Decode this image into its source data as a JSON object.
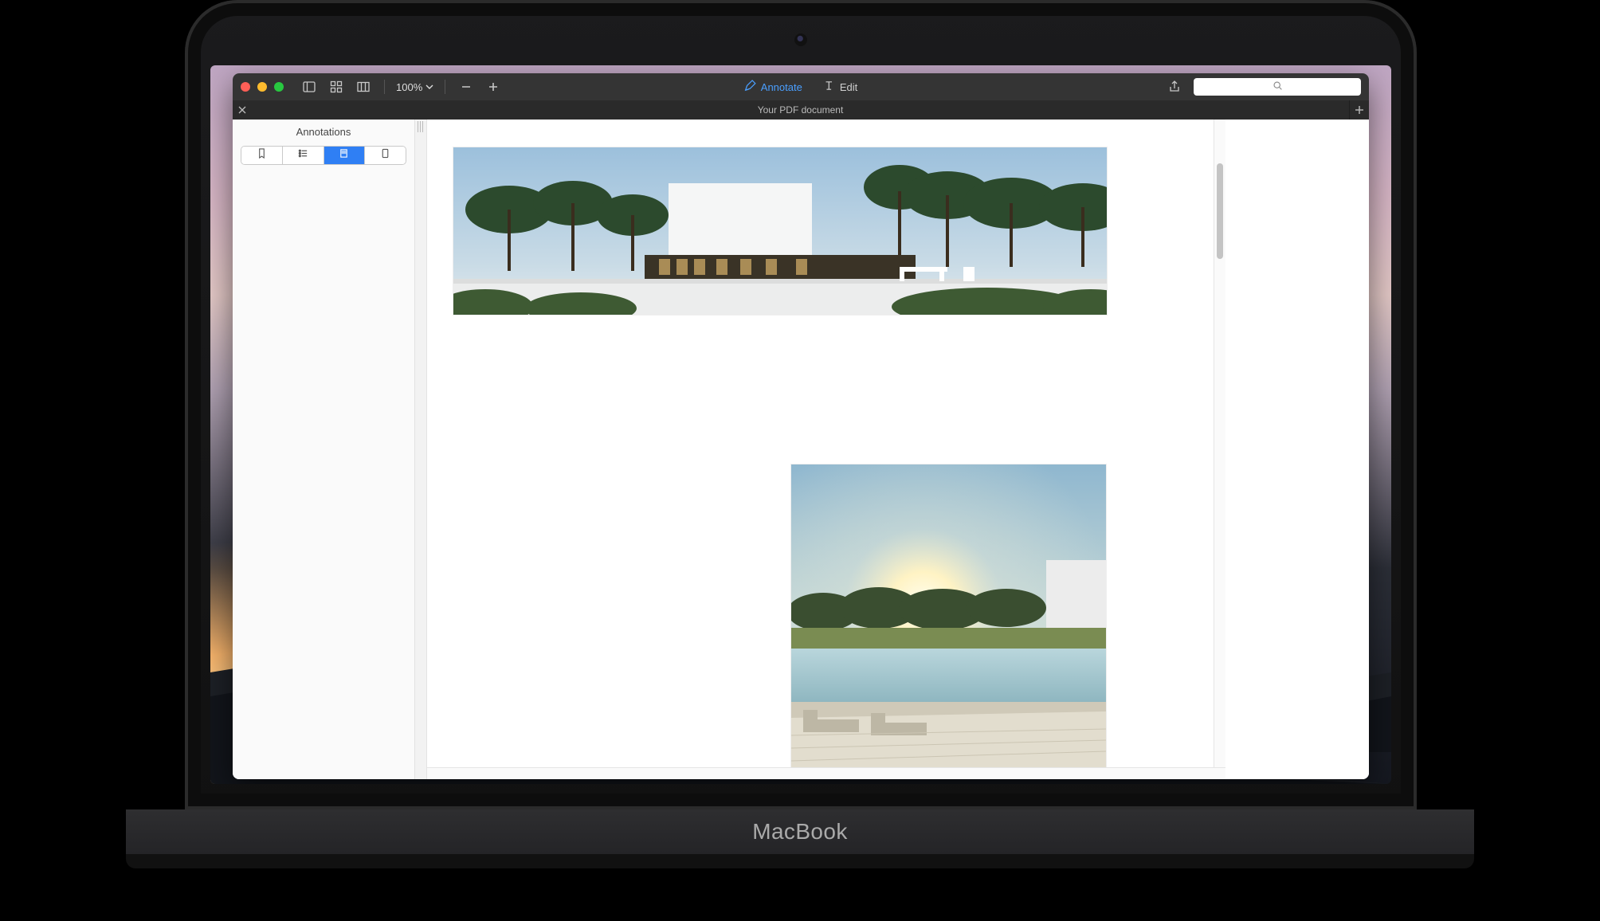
{
  "device": {
    "brand": "MacBook"
  },
  "toolbar": {
    "zoom_level": "100%",
    "mode_annotate": "Annotate",
    "mode_edit": "Edit",
    "search_placeholder": ""
  },
  "tabbar": {
    "document_title": "Your PDF document"
  },
  "sidebar": {
    "title": "Annotations",
    "view_modes": {
      "bookmarks_icon": "bookmark",
      "list_icon": "list",
      "annotations_icon": "highlight",
      "thumbnail_icon": "page",
      "active_index": 2
    }
  }
}
